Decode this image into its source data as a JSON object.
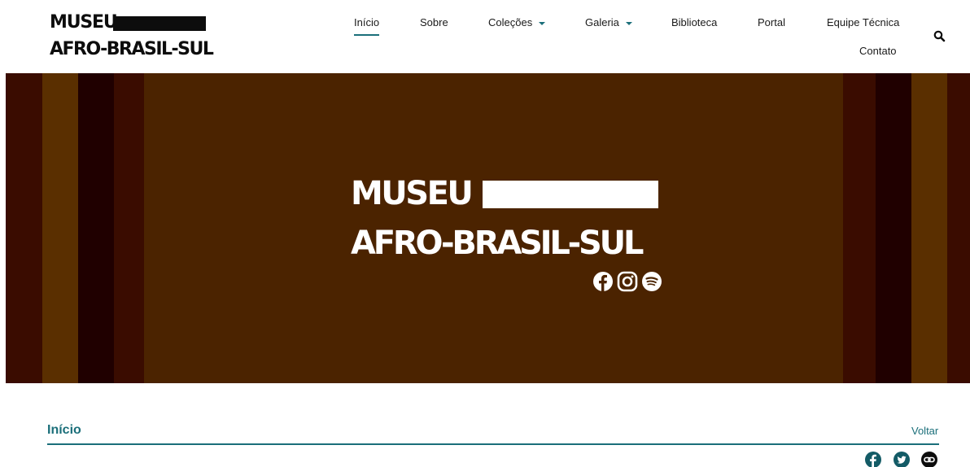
{
  "site": {
    "logo_line1": "MUSEU",
    "logo_line2": "AFRO-BRASIL-SUL"
  },
  "nav": {
    "items": [
      {
        "label": "Início",
        "active": true,
        "has_dropdown": false
      },
      {
        "label": "Sobre",
        "active": false,
        "has_dropdown": false
      },
      {
        "label": "Coleções",
        "active": false,
        "has_dropdown": true
      },
      {
        "label": "Galeria",
        "active": false,
        "has_dropdown": true
      },
      {
        "label": "Biblioteca",
        "active": false,
        "has_dropdown": false
      },
      {
        "label": "Portal",
        "active": false,
        "has_dropdown": false
      },
      {
        "label": "Equipe Técnica",
        "active": false,
        "has_dropdown": false
      },
      {
        "label": "Contato",
        "active": false,
        "has_dropdown": false
      }
    ],
    "search_icon": "search-icon"
  },
  "banner": {
    "title_line1": "MUSEU",
    "title_line2": "AFRO-BRASIL-SUL",
    "background_color": "#4b2300",
    "stripe_colors": [
      "#3a0c00",
      "#5a2f00",
      "#200000",
      "#3a0c00"
    ],
    "social_icons": [
      "facebook-icon",
      "instagram-icon",
      "spotify-icon"
    ]
  },
  "breadcrumb": {
    "title": "Início",
    "back_label": "Voltar"
  },
  "share": {
    "icons": [
      "facebook-icon",
      "twitter-icon",
      "link-icon"
    ]
  },
  "colors": {
    "accent": "#1b6f7a",
    "share_icon_bg": "#135b66",
    "text_dark": "#0d0d0d"
  }
}
